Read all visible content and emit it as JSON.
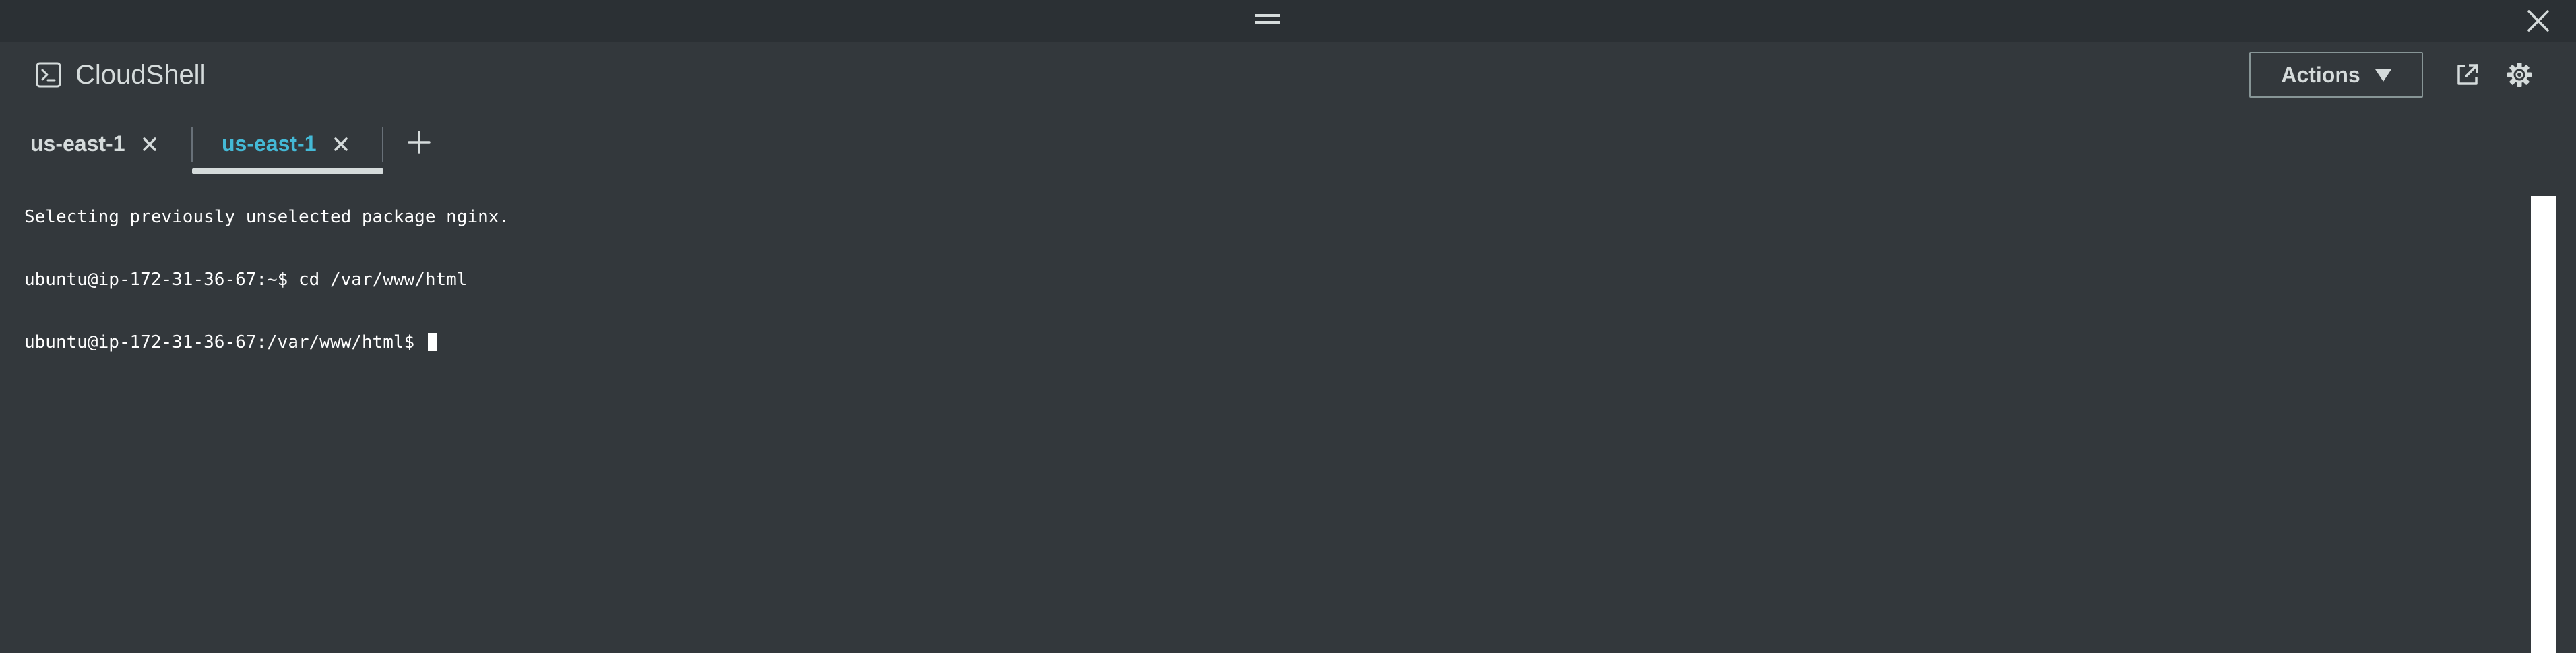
{
  "app": {
    "title": "CloudShell"
  },
  "header": {
    "actions_label": "Actions"
  },
  "tabs": [
    {
      "label": "us-east-1",
      "active": false
    },
    {
      "label": "us-east-1",
      "active": true
    }
  ],
  "terminal": {
    "lines": [
      "Selecting previously unselected package nginx.",
      "ubuntu@ip-172-31-36-67:~$ cd /var/www/html",
      "ubuntu@ip-172-31-36-67:/var/www/html$ "
    ]
  },
  "icons": {
    "drag": "drag-handle-icon",
    "close": "close-icon",
    "app": "terminal-icon",
    "actions_caret": "caret-down-icon",
    "external": "external-link-icon",
    "settings": "gear-icon",
    "tab_close": "close-icon",
    "add_tab": "plus-icon"
  },
  "colors": {
    "background": "#33383c",
    "top_bar": "#2b3034",
    "text": "#d5dbdb",
    "active_tab": "#44b9d6",
    "terminal_text": "#ffffff"
  }
}
